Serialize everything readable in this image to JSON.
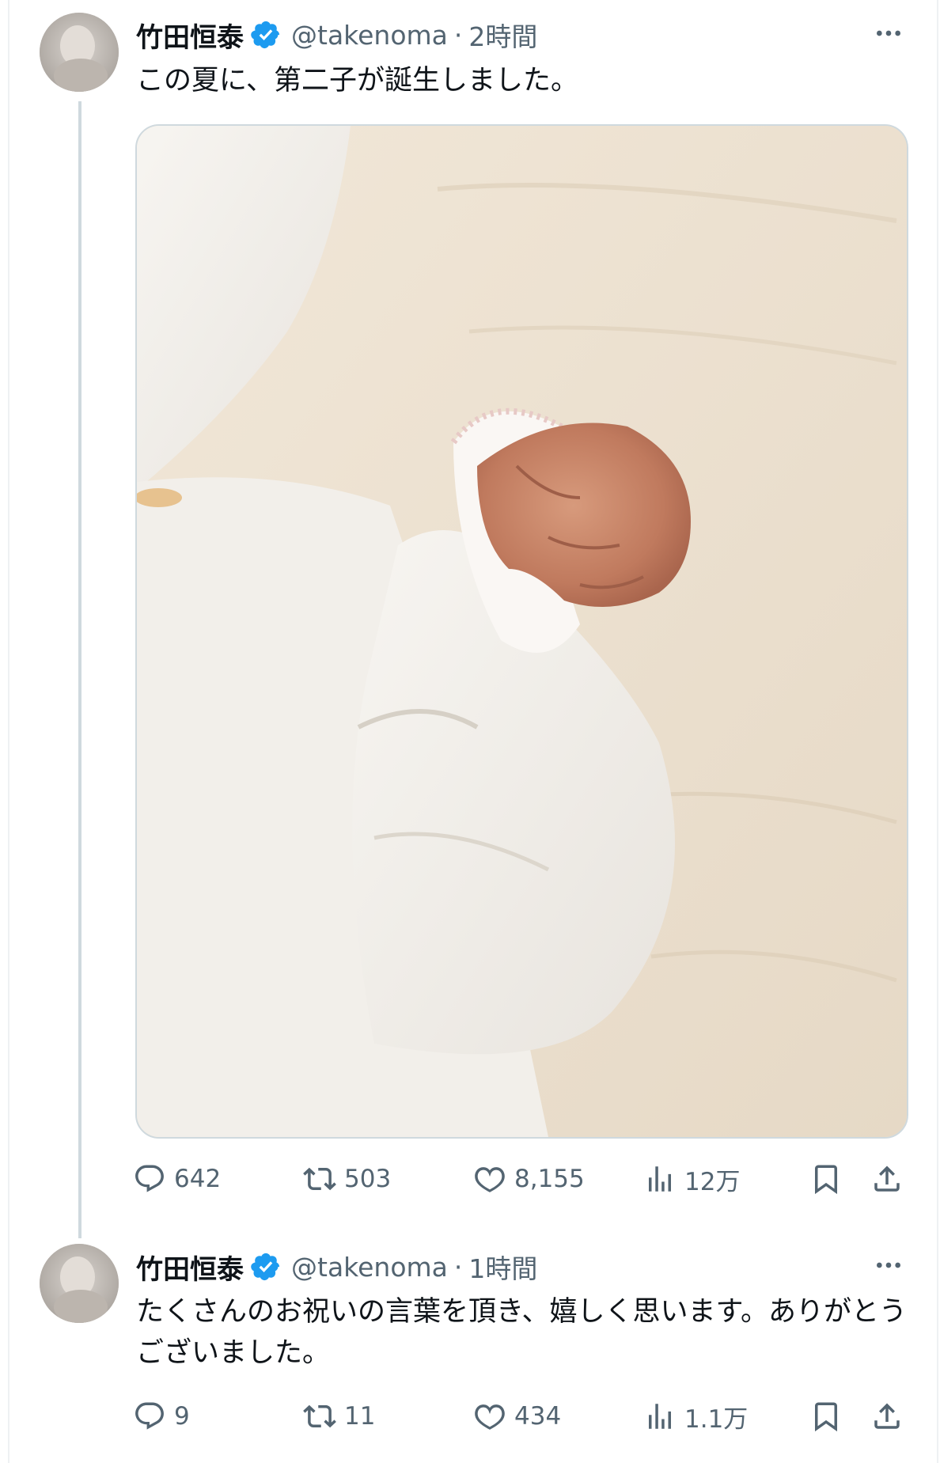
{
  "tweets": [
    {
      "author": {
        "name": "竹田恒泰",
        "handle": "@takenoma",
        "time": "2時間"
      },
      "text": "この夏に、第二子が誕生しました。",
      "media": {
        "description_icon": "photo-baby-fist"
      },
      "stats": {
        "replies": "642",
        "retweets": "503",
        "likes": "8,155",
        "views": "12万"
      }
    },
    {
      "author": {
        "name": "竹田恒泰",
        "handle": "@takenoma",
        "time": "1時間"
      },
      "text": "たくさんのお祝いの言葉を頂き、嬉しく思います。ありがとうございました。",
      "stats": {
        "replies": "9",
        "retweets": "11",
        "likes": "434",
        "views": "1.1万"
      }
    }
  ],
  "icons": {
    "verified": "verified-badge-icon",
    "more": "more-dots-icon",
    "reply": "reply-icon",
    "retweet": "retweet-icon",
    "like": "heart-icon",
    "views": "views-chart-icon",
    "bookmark": "bookmark-icon",
    "share": "share-icon"
  },
  "colors": {
    "verified": "#1d9bf0",
    "secondary_text": "#536471",
    "thread_line": "#cfd9de"
  }
}
